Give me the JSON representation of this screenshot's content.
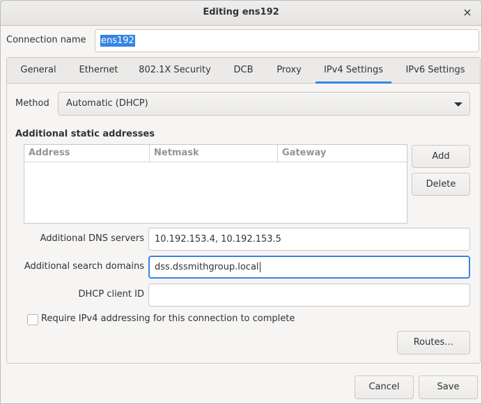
{
  "window": {
    "title": "Editing ens192",
    "close_glyph": "×"
  },
  "connection": {
    "label": "Connection name",
    "value": "ens192"
  },
  "tabs": [
    {
      "label": "General"
    },
    {
      "label": "Ethernet"
    },
    {
      "label": "802.1X Security"
    },
    {
      "label": "DCB"
    },
    {
      "label": "Proxy"
    },
    {
      "label": "IPv4 Settings",
      "active": true
    },
    {
      "label": "IPv6 Settings"
    }
  ],
  "ipv4": {
    "method_label": "Method",
    "method_value": "Automatic (DHCP)",
    "static_title": "Additional static addresses",
    "columns": [
      "Address",
      "Netmask",
      "Gateway"
    ],
    "add_label": "Add",
    "delete_label": "Delete",
    "dns_label": "Additional DNS servers",
    "dns_value": "10.192.153.4, 10.192.153.5",
    "search_label": "Additional search domains",
    "search_value": "dss.dssmithgroup.local",
    "dhcp_label": "DHCP client ID",
    "dhcp_value": "",
    "require_label": "Require IPv4 addressing for this connection to complete",
    "require_checked": false,
    "routes_label": "Routes…"
  },
  "footer": {
    "cancel_label": "Cancel",
    "save_label": "Save"
  },
  "colors": {
    "accent": "#3584e4"
  },
  "icons": {
    "close": "close-icon",
    "dropdown": "chevron-down-icon"
  }
}
